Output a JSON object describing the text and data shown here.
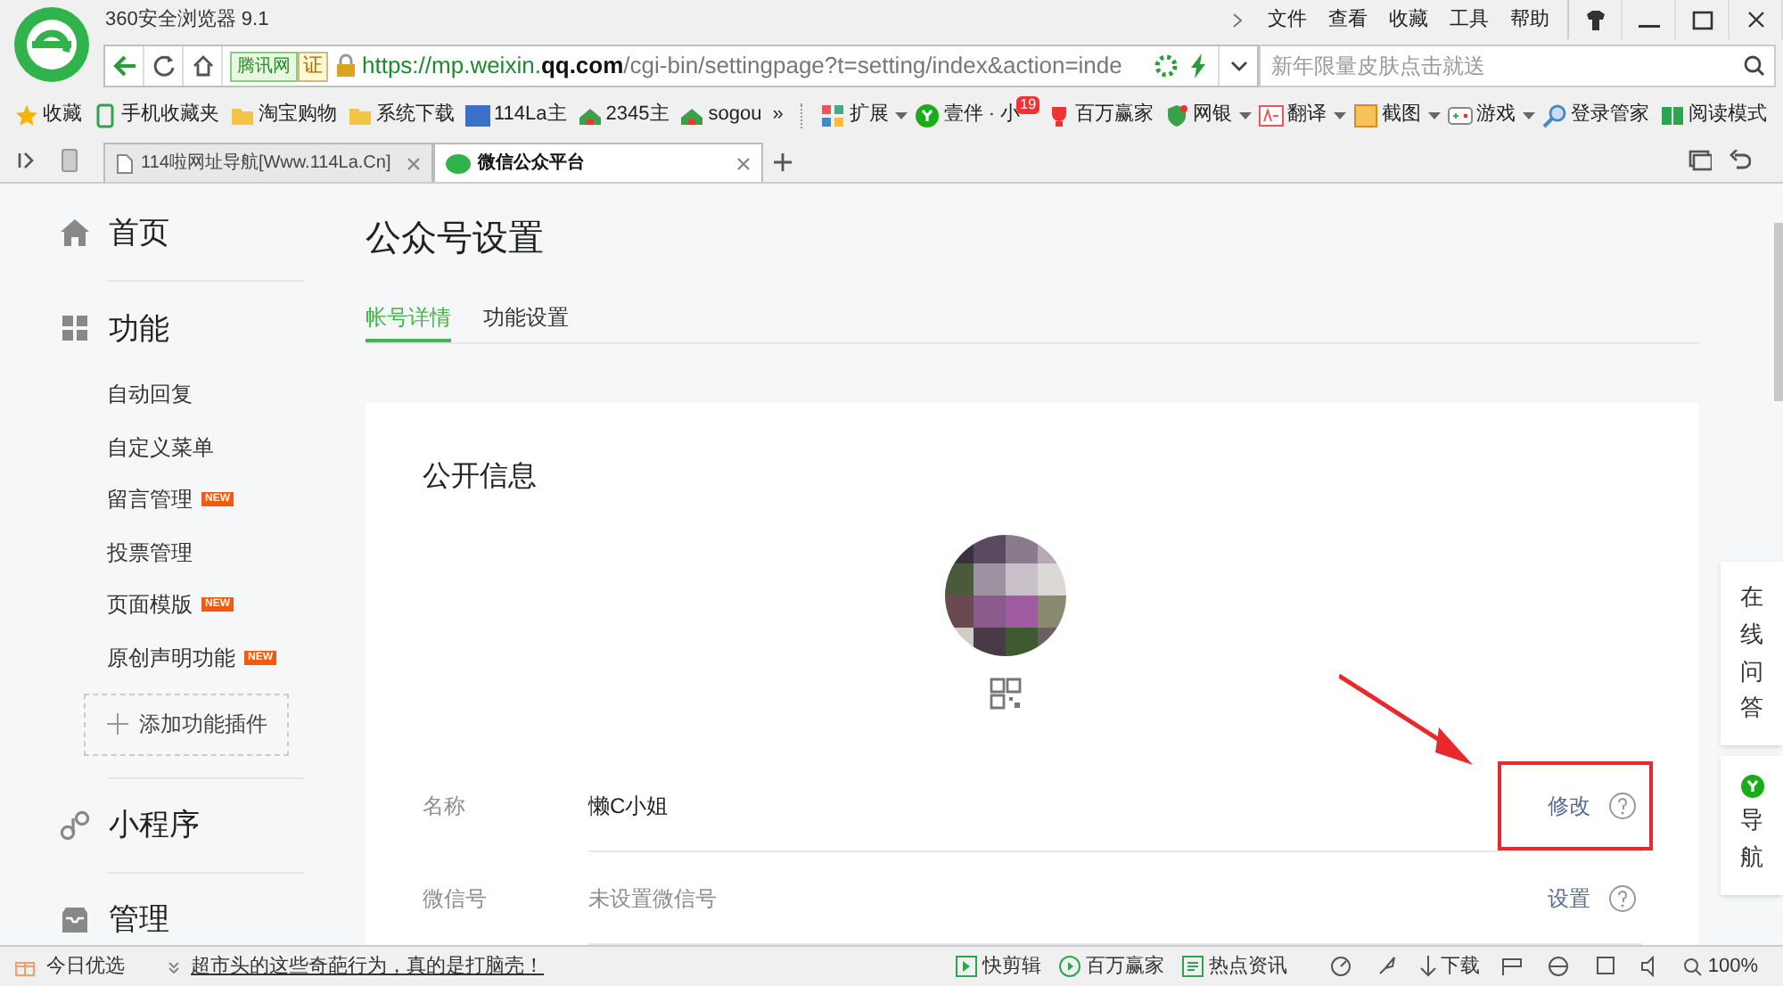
{
  "window": {
    "title": "360安全浏览器 9.1",
    "menu": [
      "文件",
      "查看",
      "收藏",
      "工具",
      "帮助"
    ]
  },
  "address_bar": {
    "site_badge": "腾讯网",
    "cert_badge": "证",
    "url": {
      "before": "https://mp.weixin.",
      "domain": "qq.com",
      "after": "/cgi-bin/settingpage?t=setting/index&action=inde"
    },
    "search_placeholder": "新年限量皮肤点击就送"
  },
  "bookmarks": [
    {
      "label": "收藏",
      "kind": "star"
    },
    {
      "label": "手机收藏夹",
      "kind": "phone"
    },
    {
      "label": "淘宝购物",
      "kind": "folder"
    },
    {
      "label": "系统下载",
      "kind": "folder"
    },
    {
      "label": "114La主",
      "kind": "site114"
    },
    {
      "label": "2345主",
      "kind": "house"
    },
    {
      "label": "sogou",
      "kind": "house"
    },
    {
      "label": "»",
      "kind": "more"
    }
  ],
  "extensions": [
    {
      "label": "扩展",
      "kind": "blocks",
      "has_menu": true
    },
    {
      "label": "壹伴 · 小",
      "kind": "yiban",
      "badge": "19"
    },
    {
      "label": "百万赢家",
      "kind": "trophy"
    },
    {
      "label": "网银",
      "kind": "shield",
      "has_menu": true
    },
    {
      "label": "翻译",
      "kind": "translate",
      "has_menu": true
    },
    {
      "label": "截图",
      "kind": "scissors",
      "has_menu": true
    },
    {
      "label": "游戏",
      "kind": "gamepad",
      "has_menu": true
    },
    {
      "label": "登录管家",
      "kind": "key"
    },
    {
      "label": "阅读模式",
      "kind": "book"
    }
  ],
  "tabs": [
    {
      "label": "114啦网址导航[Www.114La.Cn]",
      "selected": false
    },
    {
      "label": "微信公众平台",
      "selected": true
    }
  ],
  "sidebar": [
    {
      "label": "首页",
      "kind": "home"
    },
    {
      "label": "功能",
      "kind": "grid",
      "children": [
        {
          "label": "自动回复"
        },
        {
          "label": "自定义菜单"
        },
        {
          "label": "留言管理",
          "badge": "NEW"
        },
        {
          "label": "投票管理"
        },
        {
          "label": "页面模版",
          "badge": "NEW"
        },
        {
          "label": "原创声明功能",
          "badge": "NEW"
        }
      ],
      "add_button": "添加功能插件"
    },
    {
      "label": "小程序",
      "kind": "link"
    },
    {
      "label": "管理",
      "kind": "tray"
    }
  ],
  "page": {
    "title": "公众号设置",
    "tabs": [
      {
        "label": "帐号详情",
        "selected": true
      },
      {
        "label": "功能设置",
        "selected": false
      }
    ],
    "section_title": "公开信息",
    "fields": [
      {
        "label": "名称",
        "value": "懒C小姐",
        "unset": false,
        "action": "修改",
        "highlighted": true
      },
      {
        "label": "微信号",
        "value": "未设置微信号",
        "unset": true,
        "action": "设置",
        "highlighted": false
      }
    ]
  },
  "float_panel": [
    {
      "label": "在线问答",
      "kind": "text"
    },
    {
      "label": "导航",
      "kind": "nav"
    }
  ],
  "status_bar": {
    "left": "今日优选",
    "news": "超市头的这些奇葩行为，真的是打脑壳！",
    "items": [
      {
        "label": "快剪辑",
        "kind": "clip"
      },
      {
        "label": "百万赢家",
        "kind": "play"
      },
      {
        "label": "热点资讯",
        "kind": "news"
      }
    ],
    "download": "下载",
    "zoom": "100%"
  }
}
